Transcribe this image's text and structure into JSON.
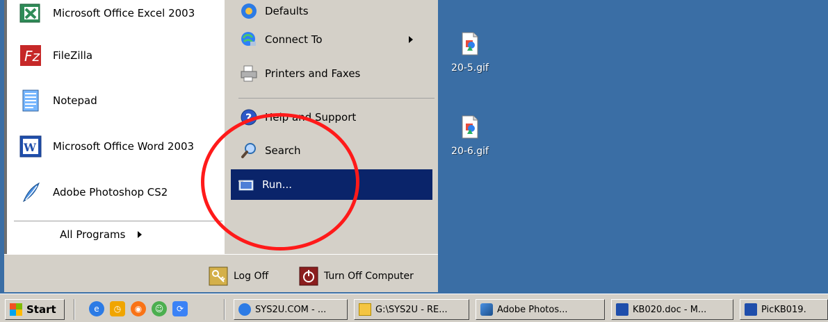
{
  "desktop": {
    "icons": [
      {
        "label": "20-5.gif",
        "icon": "gif-image-icon"
      },
      {
        "label": "20-6.gif",
        "icon": "gif-image-icon"
      }
    ],
    "background_color": "#3a6ea5"
  },
  "start_menu": {
    "left_items": [
      {
        "label": "Microsoft Office Excel 2003",
        "icon": "excel-icon"
      },
      {
        "label": "FileZilla",
        "icon": "filezilla-icon"
      },
      {
        "label": "Notepad",
        "icon": "notepad-icon"
      },
      {
        "label": "Microsoft Office Word 2003",
        "icon": "word-icon"
      },
      {
        "label": "Adobe Photoshop CS2",
        "icon": "photoshop-icon"
      }
    ],
    "all_programs_label": "All Programs",
    "right_items": [
      {
        "label": "Defaults",
        "icon": "defaults-icon"
      },
      {
        "label": "Connect To",
        "icon": "connect-to-icon"
      },
      {
        "label": "Printers and Faxes",
        "icon": "printer-icon"
      },
      {
        "label": "Help and Support",
        "icon": "help-icon"
      },
      {
        "label": "Search",
        "icon": "search-icon"
      },
      {
        "label": "Run...",
        "icon": "run-icon",
        "selected": true
      }
    ],
    "log_off_label": "Log Off",
    "turn_off_label": "Turn Off Computer",
    "selected_color": "#0a246a"
  },
  "taskbar": {
    "start_label": "Start",
    "quick_launch": [
      {
        "icon": "internet-explorer-icon"
      },
      {
        "icon": "clock-icon"
      },
      {
        "icon": "firefox-icon"
      },
      {
        "icon": "messenger-icon"
      },
      {
        "icon": "browser-icon"
      }
    ],
    "tasks": [
      {
        "label": "SYS2U.COM - ...",
        "icon": "internet-explorer-icon"
      },
      {
        "label": "G:\\SYS2U - RE...",
        "icon": "folder-icon"
      },
      {
        "label": "Adobe Photos...",
        "icon": "photoshop-icon"
      },
      {
        "label": "KB020.doc - M...",
        "icon": "word-icon"
      },
      {
        "label": "PicKB019.",
        "icon": "word-icon"
      }
    ]
  },
  "annotation": {
    "color": "#ff1a1a"
  }
}
